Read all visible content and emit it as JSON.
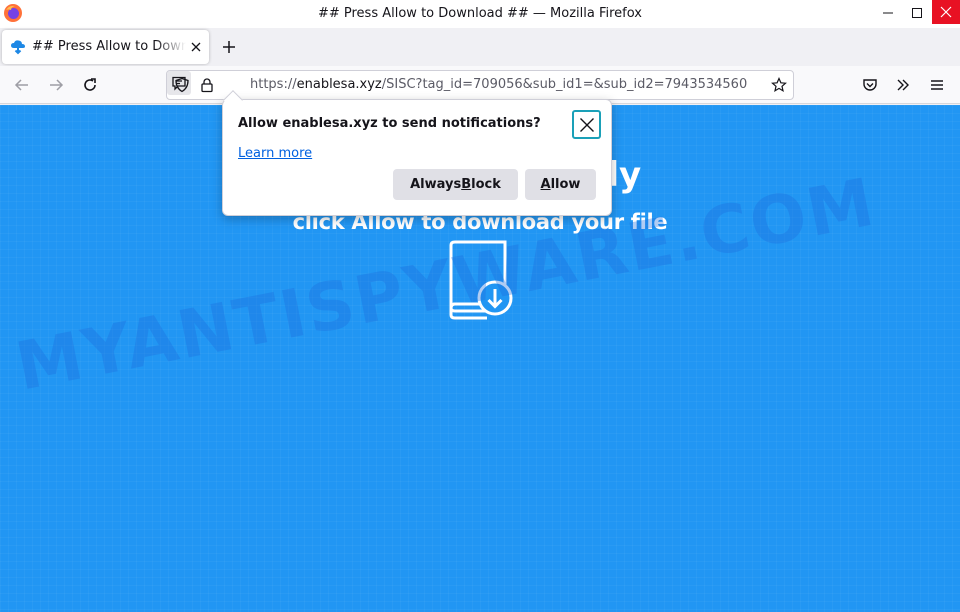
{
  "window": {
    "title": "## Press Allow to Download ## — Mozilla Firefox"
  },
  "tab": {
    "title": "## Press Allow to Download ##"
  },
  "urlbar": {
    "scheme": "https://",
    "domain": "enablesa.xyz",
    "path": "/SISC?tag_id=709056&sub_id1=&sub_id2=7943534560"
  },
  "page": {
    "headline": "Your file is ready",
    "subline": "click Allow to download your file",
    "watermark": "MYANTISPYWARE.COM"
  },
  "popup": {
    "message": "Allow enablesa.xyz to send notifications?",
    "learn_more": "Learn more",
    "block_label_pre": "Always ",
    "block_label_key": "B",
    "block_label_post": "lock",
    "allow_label_key": "A",
    "allow_label_post": "llow"
  },
  "colors": {
    "page_background": "#2196f3",
    "close_button": "#e81123",
    "link": "#0061e0"
  }
}
